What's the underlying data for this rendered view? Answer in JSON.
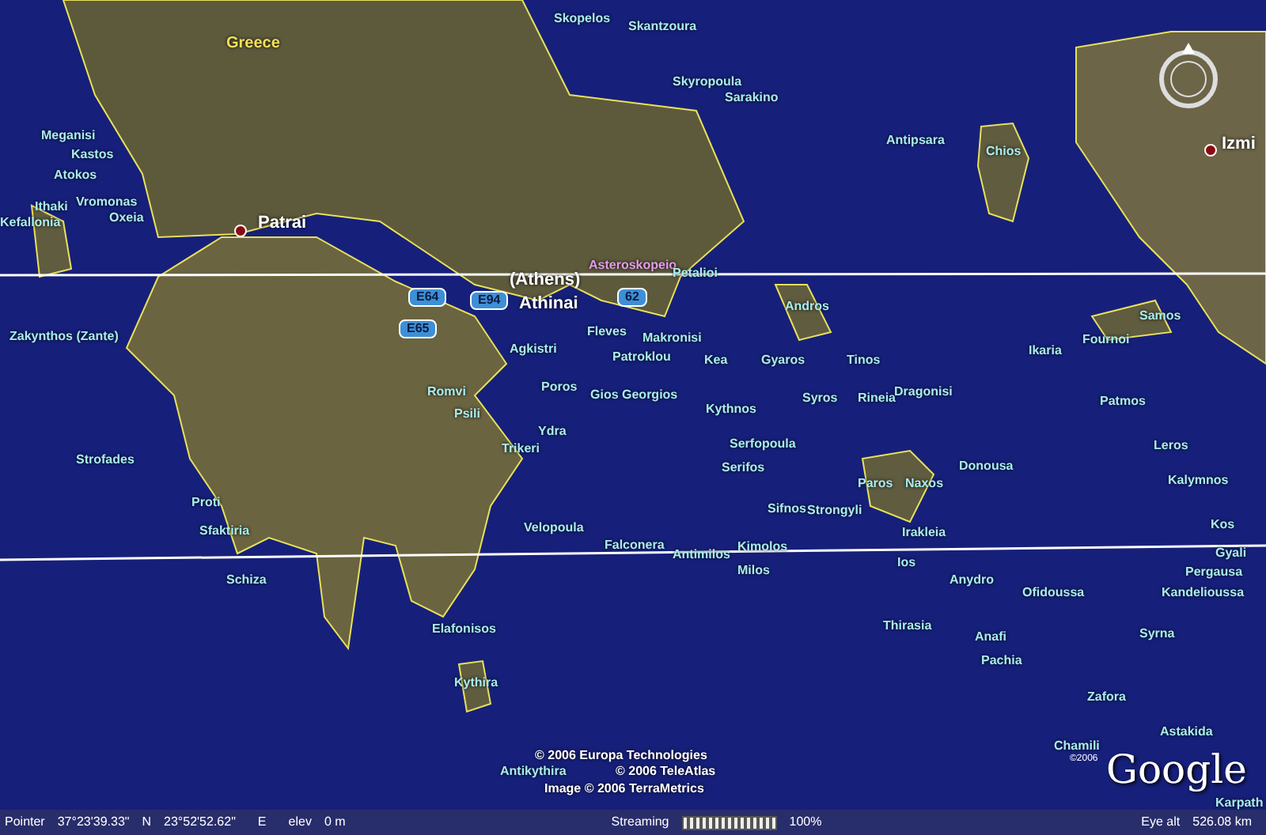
{
  "map": {
    "labels": [
      {
        "kind": "country",
        "text": "Greece"
      },
      {
        "kind": "place",
        "text": "Skopelos"
      },
      {
        "kind": "place",
        "text": "Skantzoura"
      },
      {
        "kind": "place",
        "text": "Skyropoula"
      },
      {
        "kind": "place",
        "text": "Sarakino"
      },
      {
        "kind": "place",
        "text": "Antipsara"
      },
      {
        "kind": "place",
        "text": "Chios"
      },
      {
        "kind": "city",
        "text": "Izmi"
      },
      {
        "kind": "place",
        "text": "Meganisi"
      },
      {
        "kind": "place",
        "text": "Kastos"
      },
      {
        "kind": "place",
        "text": "Atokos"
      },
      {
        "kind": "place",
        "text": "Ithaki"
      },
      {
        "kind": "place",
        "text": "Vromonas"
      },
      {
        "kind": "place",
        "text": "Oxeia"
      },
      {
        "kind": "place",
        "text": "Kefallonia"
      },
      {
        "kind": "city",
        "text": "Patrai"
      },
      {
        "kind": "city",
        "text": "(Athens)"
      },
      {
        "kind": "poi",
        "text": "Asteroskopeio"
      },
      {
        "kind": "place",
        "text": "Petalioi"
      },
      {
        "kind": "road",
        "text": "E64"
      },
      {
        "kind": "road",
        "text": "E94"
      },
      {
        "kind": "city",
        "text": "Athinai"
      },
      {
        "kind": "road",
        "text": "62"
      },
      {
        "kind": "road",
        "text": "E65"
      },
      {
        "kind": "place",
        "text": "Zakynthos (Zante)"
      },
      {
        "kind": "place",
        "text": "Andros"
      },
      {
        "kind": "place",
        "text": "Samos"
      },
      {
        "kind": "place",
        "text": "Fleves"
      },
      {
        "kind": "place",
        "text": "Makronisi"
      },
      {
        "kind": "place",
        "text": "Agkistri"
      },
      {
        "kind": "place",
        "text": "Patroklou"
      },
      {
        "kind": "place",
        "text": "Kea"
      },
      {
        "kind": "place",
        "text": "Gyaros"
      },
      {
        "kind": "place",
        "text": "Tinos"
      },
      {
        "kind": "place",
        "text": "Fournoi"
      },
      {
        "kind": "place",
        "text": "Ikaria"
      },
      {
        "kind": "place",
        "text": "Poros"
      },
      {
        "kind": "place",
        "text": "Romvi"
      },
      {
        "kind": "place",
        "text": "Gios Georgios"
      },
      {
        "kind": "place",
        "text": "Syros"
      },
      {
        "kind": "place",
        "text": "Rineia"
      },
      {
        "kind": "place",
        "text": "Dragonisi"
      },
      {
        "kind": "place",
        "text": "Patmos"
      },
      {
        "kind": "place",
        "text": "Psili"
      },
      {
        "kind": "place",
        "text": "Kythnos"
      },
      {
        "kind": "place",
        "text": "Ydra"
      },
      {
        "kind": "place",
        "text": "Trikeri"
      },
      {
        "kind": "place",
        "text": "Serfopoula"
      },
      {
        "kind": "place",
        "text": "Leros"
      },
      {
        "kind": "place",
        "text": "Strofades"
      },
      {
        "kind": "place",
        "text": "Serifos"
      },
      {
        "kind": "place",
        "text": "Paros"
      },
      {
        "kind": "place",
        "text": "Naxos"
      },
      {
        "kind": "place",
        "text": "Donousa"
      },
      {
        "kind": "place",
        "text": "Kalymnos"
      },
      {
        "kind": "place",
        "text": "Proti"
      },
      {
        "kind": "place",
        "text": "Sifnos"
      },
      {
        "kind": "place",
        "text": "Strongyli"
      },
      {
        "kind": "place",
        "text": "Sfaktiria"
      },
      {
        "kind": "place",
        "text": "Velopoula"
      },
      {
        "kind": "place",
        "text": "Irakleia"
      },
      {
        "kind": "place",
        "text": "Kos"
      },
      {
        "kind": "place",
        "text": "Falconera"
      },
      {
        "kind": "place",
        "text": "Antimilos"
      },
      {
        "kind": "place",
        "text": "Kimolos"
      },
      {
        "kind": "place",
        "text": "Gyali"
      },
      {
        "kind": "place",
        "text": "Milos"
      },
      {
        "kind": "place",
        "text": "Ios"
      },
      {
        "kind": "place",
        "text": "Schiza"
      },
      {
        "kind": "place",
        "text": "Pergausa"
      },
      {
        "kind": "place",
        "text": "Anydro"
      },
      {
        "kind": "place",
        "text": "Ofidoussa"
      },
      {
        "kind": "place",
        "text": "Kandelioussa"
      },
      {
        "kind": "place",
        "text": "Elafonisos"
      },
      {
        "kind": "place",
        "text": "Thirasia"
      },
      {
        "kind": "place",
        "text": "Anafi"
      },
      {
        "kind": "place",
        "text": "Syrna"
      },
      {
        "kind": "place",
        "text": "Pachia"
      },
      {
        "kind": "place",
        "text": "Kythira"
      },
      {
        "kind": "place",
        "text": "Zafora"
      },
      {
        "kind": "place",
        "text": "Astakida"
      },
      {
        "kind": "place",
        "text": "Chamili"
      },
      {
        "kind": "place",
        "text": "Antikythira"
      },
      {
        "kind": "place",
        "text": "Karpath"
      }
    ],
    "attribution": [
      "© 2006 Europa Technologies",
      "© 2006 TeleAtlas",
      "Image © 2006 TerraMetrics"
    ],
    "logo": {
      "text": "Google",
      "copyright": "©2006"
    }
  },
  "status_bar": {
    "pointer_label": "Pointer",
    "latitude": "37°23'39.33\"",
    "lat_hemisphere": "N",
    "longitude": "23°52'52.62\"",
    "lon_hemisphere": "E",
    "elev_label": "elev",
    "elevation": "0 m",
    "streaming_label": "Streaming",
    "streaming": {
      "level": 1
    },
    "streaming_percent": "100%",
    "eye_alt_label": "Eye alt",
    "eye_alt": "526.08 km"
  }
}
